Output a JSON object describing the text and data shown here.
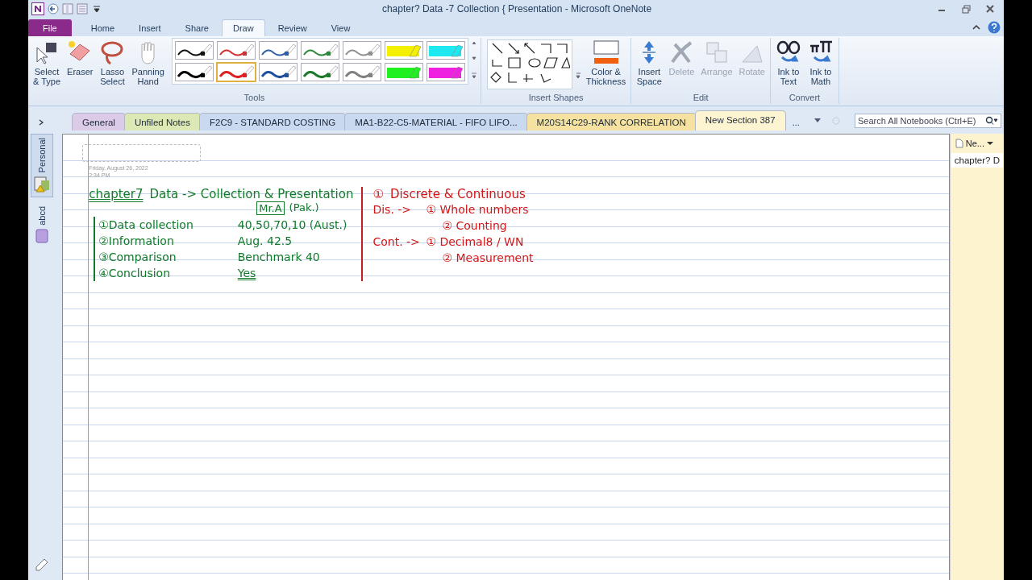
{
  "window": {
    "title": "chapter? Data -7 Collection { Presentation  -  Microsoft OneNote"
  },
  "ribbon_tabs": [
    {
      "label": "File",
      "kind": "file",
      "selected": false
    },
    {
      "label": "Home",
      "kind": "tab",
      "selected": false
    },
    {
      "label": "Insert",
      "kind": "tab",
      "selected": false
    },
    {
      "label": "Share",
      "kind": "tab",
      "selected": false
    },
    {
      "label": "Draw",
      "kind": "tab",
      "selected": true
    },
    {
      "label": "Review",
      "kind": "tab",
      "selected": false
    },
    {
      "label": "View",
      "kind": "tab",
      "selected": false
    }
  ],
  "tools": {
    "label": "Tools",
    "buttons": [
      {
        "label": "Select\n& Type",
        "kind": "select"
      },
      {
        "label": "Eraser",
        "kind": "eraser"
      },
      {
        "label": "Lasso\nSelect",
        "kind": "lasso"
      },
      {
        "label": "Panning\nHand",
        "kind": "hand"
      }
    ],
    "pens": [
      {
        "kind": "pen",
        "color": "#111111",
        "selected": false
      },
      {
        "kind": "pen",
        "color": "#d23030",
        "selected": false
      },
      {
        "kind": "pen",
        "color": "#3060a8",
        "selected": false
      },
      {
        "kind": "pen",
        "color": "#2a8a3a",
        "selected": false
      },
      {
        "kind": "pen",
        "color": "#909090",
        "selected": false
      },
      {
        "kind": "highlighter",
        "color": "#f4f000",
        "selected": false
      },
      {
        "kind": "highlighter",
        "color": "#20e8f0",
        "selected": false
      },
      {
        "kind": "pen",
        "color": "#000000",
        "selected": false
      },
      {
        "kind": "pen",
        "color": "#e02020",
        "selected": true
      },
      {
        "kind": "pen",
        "color": "#2050a0",
        "selected": false
      },
      {
        "kind": "pen",
        "color": "#1a7a2a",
        "selected": false
      },
      {
        "kind": "pen",
        "color": "#808080",
        "selected": false
      },
      {
        "kind": "highlighter",
        "color": "#20f020",
        "selected": false
      },
      {
        "kind": "highlighter",
        "color": "#f020e0",
        "selected": false
      }
    ]
  },
  "insert_shapes": {
    "label": "Insert Shapes"
  },
  "color_thickness": {
    "label": "Color &\nThickness"
  },
  "edit": {
    "label": "Edit",
    "buttons": [
      {
        "label": "Insert\nSpace",
        "kind": "space",
        "disabled": false
      },
      {
        "label": "Delete",
        "kind": "delete",
        "disabled": true
      },
      {
        "label": "Arrange",
        "kind": "arrange",
        "disabled": true
      },
      {
        "label": "Rotate",
        "kind": "rotate",
        "disabled": true
      }
    ]
  },
  "convert": {
    "label": "Convert",
    "buttons": [
      {
        "label": "Ink to\nText",
        "kind": "text"
      },
      {
        "label": "Ink to\nMath",
        "kind": "math"
      }
    ]
  },
  "notebooks": [
    {
      "label": "Personal",
      "selected": true
    },
    {
      "label": "abcd",
      "selected": false
    }
  ],
  "sections": [
    {
      "label": "General",
      "color": "#dccbe8",
      "selected": false
    },
    {
      "label": "Unfiled Notes",
      "color": "#dde9b4",
      "selected": false
    },
    {
      "label": "F2C9 - STANDARD COSTING",
      "color": "#c9d9ef",
      "selected": false
    },
    {
      "label": "MA1-B22-C5-MATERIAL - FIFO LIFO...",
      "color": "#c9d9ef",
      "selected": false
    },
    {
      "label": "M20S14C29-RANK CORRELATION",
      "color": "#f5e2a0",
      "selected": false
    },
    {
      "label": "New Section 387",
      "color": "#fdf4d2",
      "selected": true
    }
  ],
  "section_more": "...",
  "search": {
    "placeholder": "Search All Notebooks (Ctrl+E)"
  },
  "page": {
    "date": "Friday, August 26, 2022",
    "time": "2:34 PM",
    "left_notes": {
      "title_underlined": "chapter7",
      "title": "Data -> Collection & Presentation",
      "boxed": "Mr.A",
      "after_box": "(Pak.)",
      "items": [
        {
          "number": "①",
          "text": "Data collection",
          "value": "40,50,70,10 (Aust.)",
          "underlined": false
        },
        {
          "number": "②",
          "text": "Information",
          "value": "Aug.  42.5",
          "underlined": false
        },
        {
          "number": "③",
          "text": "Comparison",
          "value": "Benchmark 40",
          "underlined": false
        },
        {
          "number": "④",
          "text": "Conclusion",
          "value": "Yes",
          "underlined": true
        }
      ]
    },
    "right_notes": {
      "heading_number": "①",
      "heading": "Discrete & Continuous",
      "groups": [
        {
          "label": "Dis. ->",
          "items": [
            {
              "number": "①",
              "text": "Whole numbers"
            },
            {
              "number": "②",
              "text": "Counting"
            }
          ]
        },
        {
          "label": "Cont. ->",
          "items": [
            {
              "number": "①",
              "text": "Decimal8 / WN"
            },
            {
              "number": "②",
              "text": "Measurement"
            }
          ]
        }
      ]
    }
  },
  "page_list": {
    "new_page": "Ne...",
    "pages": [
      {
        "label": "chapter? D",
        "selected": true
      }
    ]
  }
}
